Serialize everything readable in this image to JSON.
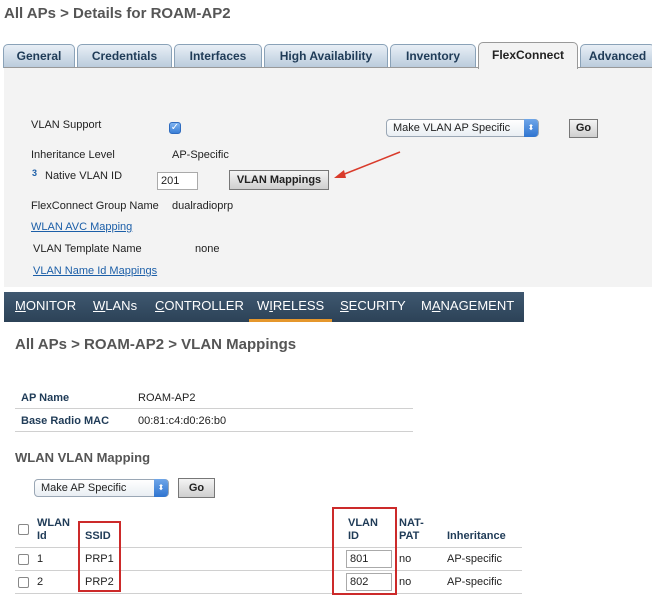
{
  "page1": {
    "breadcrumb": "All APs > Details for ROAM-AP2",
    "tabs": [
      {
        "label": "General",
        "active": false
      },
      {
        "label": "Credentials",
        "active": false
      },
      {
        "label": "Interfaces",
        "active": false
      },
      {
        "label": "High Availability",
        "active": false
      },
      {
        "label": "Inventory",
        "active": false
      },
      {
        "label": "FlexConnect",
        "active": true
      },
      {
        "label": "Advanced",
        "active": false
      }
    ],
    "vlan_support_label": "VLAN Support",
    "vlan_support_checked": true,
    "ap_specific_select": "Make VLAN AP Specific",
    "go_label": "Go",
    "inheritance_level_label": "Inheritance Level",
    "inheritance_level_value": "AP-Specific",
    "footnote_marker": "3",
    "native_vlan_label": "Native VLAN ID",
    "native_vlan_value": "201",
    "vlan_mappings_button": "VLAN Mappings",
    "flexconnect_group_label": "FlexConnect Group Name",
    "flexconnect_group_value": "dualradioprp",
    "wlan_avc_link": "WLAN AVC Mapping",
    "vlan_template_label": "VLAN Template Name",
    "vlan_template_value": "none",
    "vlan_name_id_link": "VLAN Name Id Mappings",
    "arrow_color": "#d93b2b"
  },
  "menu": {
    "items": [
      {
        "label": "MONITOR",
        "accesskey": "M",
        "active": false
      },
      {
        "label": "WLANs",
        "accesskey": "W",
        "active": false
      },
      {
        "label": "CONTROLLER",
        "accesskey": "C",
        "active": false
      },
      {
        "label": "WIRELESS",
        "accesskey": "I",
        "active": true
      },
      {
        "label": "SECURITY",
        "accesskey": "S",
        "active": false
      },
      {
        "label": "MANAGEMENT",
        "accesskey": "A",
        "active": false
      }
    ],
    "accent_color": "#e5972c",
    "bar_color": "#34495f"
  },
  "page2": {
    "breadcrumb": "All APs > ROAM-AP2 > VLAN Mappings",
    "ap_name_label": "AP Name",
    "ap_name_value": "ROAM-AP2",
    "base_radio_mac_label": "Base Radio MAC",
    "base_radio_mac_value": "00:81:c4:d0:26:b0",
    "section_title": "WLAN VLAN Mapping",
    "select_value": "Make AP Specific",
    "go_label": "Go",
    "columns": {
      "wlan_id_1": "WLAN",
      "wlan_id_2": "Id",
      "ssid": "SSID",
      "vlan_id_1": "VLAN",
      "vlan_id_2": "ID",
      "nat_pat_1": "NAT-",
      "nat_pat_2": "PAT",
      "inheritance": "Inheritance"
    },
    "rows": [
      {
        "wlan_id": "1",
        "ssid": "PRP1",
        "vlan_id": "801",
        "nat_pat": "no",
        "inheritance": "AP-specific"
      },
      {
        "wlan_id": "2",
        "ssid": "PRP2",
        "vlan_id": "802",
        "nat_pat": "no",
        "inheritance": "AP-specific"
      }
    ],
    "highlight_color": "#cc2a2a"
  }
}
